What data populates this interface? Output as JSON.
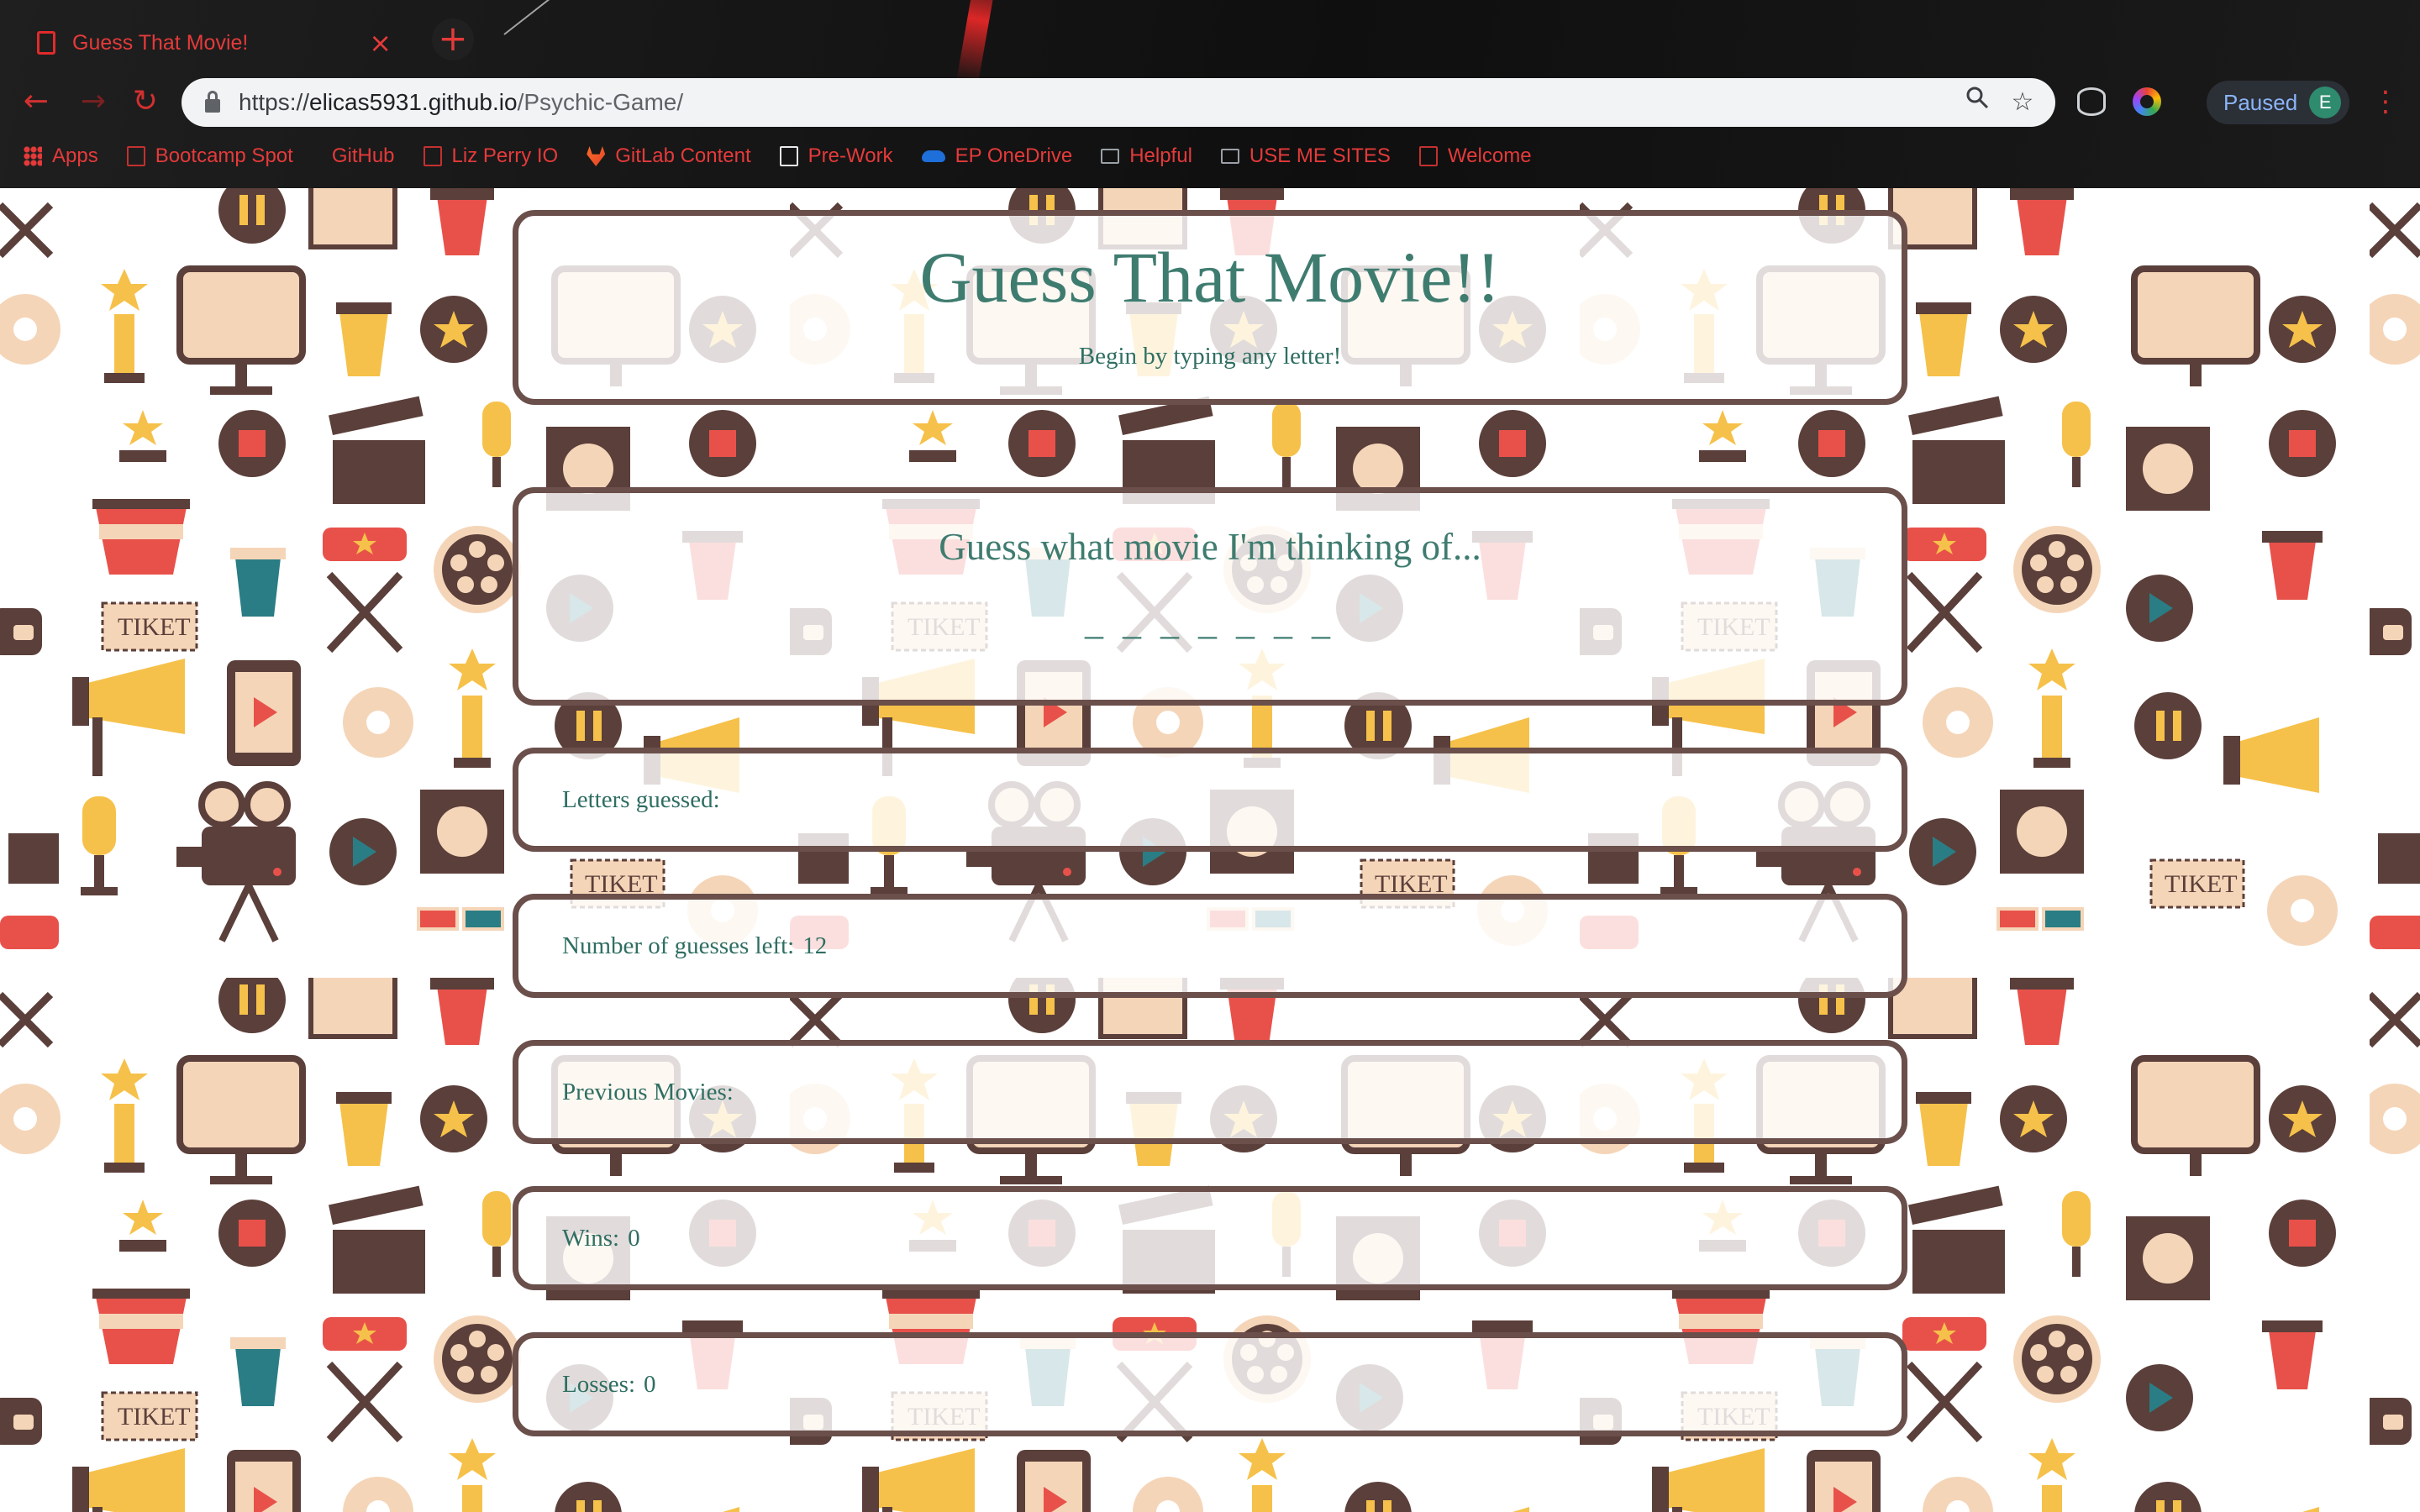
{
  "browser": {
    "tab_title": "Guess That Movie!",
    "tab_close": "×",
    "new_tab": "+",
    "url_scheme": "https://",
    "url_host": "elicas5931.github.io",
    "url_path": "/Psychic-Game/",
    "profile_status": "Paused",
    "profile_initial": "E",
    "accent_color": "#e53a3a",
    "bookmarks": [
      {
        "label": "Apps",
        "icon": "apps-grid-icon"
      },
      {
        "label": "Bootcamp Spot",
        "icon": "page-icon"
      },
      {
        "label": "GitHub",
        "icon": "github-icon"
      },
      {
        "label": "Liz Perry IO",
        "icon": "page-icon"
      },
      {
        "label": "GitLab Content",
        "icon": "gitlab-icon"
      },
      {
        "label": "Pre-Work",
        "icon": "book-icon"
      },
      {
        "label": "EP OneDrive",
        "icon": "onedrive-icon"
      },
      {
        "label": "Helpful",
        "icon": "folder-icon"
      },
      {
        "label": "USE ME SITES",
        "icon": "folder-icon"
      },
      {
        "label": "Welcome",
        "icon": "page-icon"
      }
    ]
  },
  "game": {
    "title": "Guess That Movie!!",
    "subtitle": "Begin by typing any letter!",
    "prompt": "Guess what movie I'm thinking of...",
    "blanks": "_ _ _ _ _ _ _",
    "letters_guessed_label": "Letters guessed:",
    "letters_guessed_value": "",
    "guesses_left_label": "Number of guesses left:",
    "guesses_left_value": "12",
    "previous_movies_label": "Previous Movies:",
    "previous_movies_value": "",
    "wins_label": "Wins:",
    "wins_value": "0",
    "losses_label": "Losses:",
    "losses_value": "0"
  },
  "colors": {
    "text_teal": "#3f7c70",
    "panel_border": "#6a4f4b",
    "pattern_brown": "#5b3f3a",
    "pattern_red": "#e8514a",
    "pattern_peach": "#f5d5b8",
    "pattern_yellow": "#f6c14a",
    "pattern_teal": "#2a7d84"
  }
}
